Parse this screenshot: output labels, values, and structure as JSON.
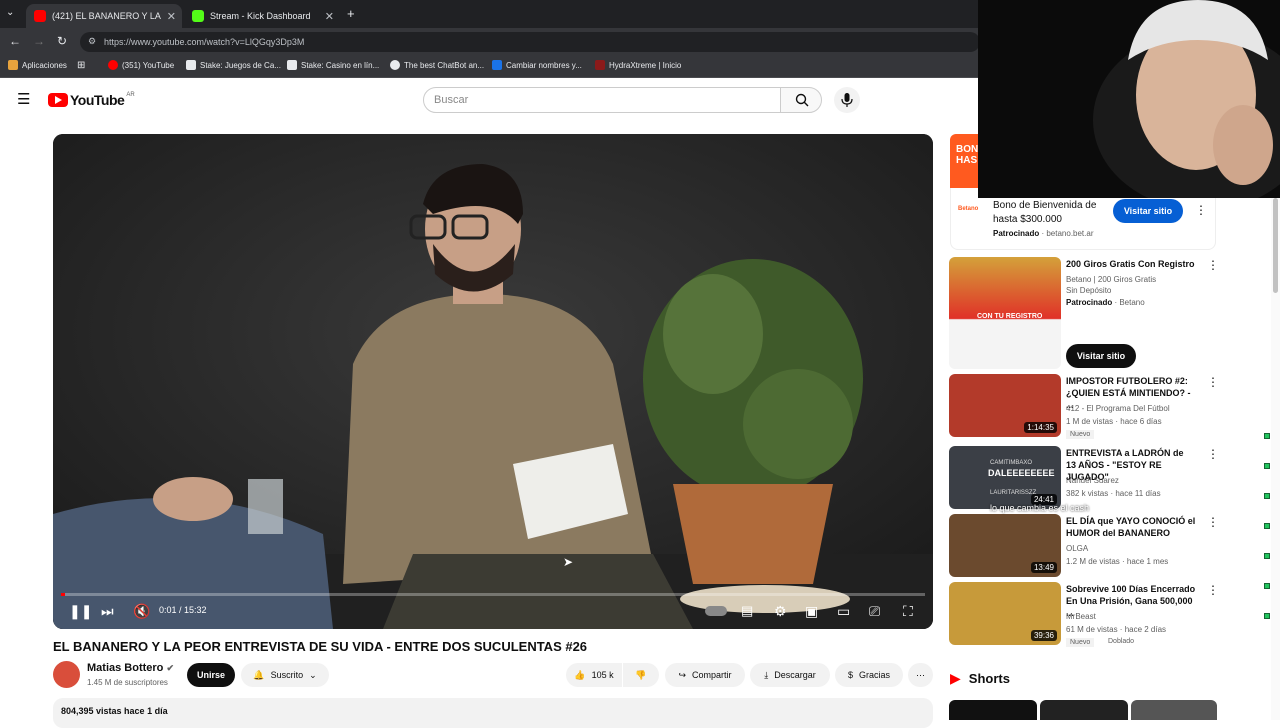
{
  "tabs": [
    {
      "title": "(421) EL BANANERO Y LA PEOR",
      "fav_color": "#ff0000"
    },
    {
      "title": "Stream - Kick Dashboard",
      "fav_color": "#53fc18"
    }
  ],
  "url": "https://www.youtube.com/watch?v=LlQGqy3Dp3M",
  "bookmarks": [
    {
      "label": "Aplicaciones",
      "color": "#e8a33d"
    },
    {
      "label": "(351) YouTube",
      "color": "#ff0000"
    },
    {
      "label": "Stake: Juegos de Ca...",
      "color": "#e8eaed"
    },
    {
      "label": "Stake: Casino en lín...",
      "color": "#e8eaed"
    },
    {
      "label": "The best ChatBot an...",
      "color": "#e8eaed"
    },
    {
      "label": "Cambiar nombres y...",
      "color": "#1a73e8"
    },
    {
      "label": "HydraXtreme | Inicio",
      "color": "#8b1a1a"
    }
  ],
  "youtube": {
    "logo": "YouTube",
    "region": "AR",
    "search_placeholder": "Buscar"
  },
  "player": {
    "time": "0:01 / 15:32",
    "progress": 0.001
  },
  "video": {
    "title": "EL BANANERO Y LA PEOR ENTREVISTA DE SU VIDA - ENTRE DOS SUCULENTAS #26",
    "channel": "Matias Bottero",
    "subscribers": "1.45 M de suscriptores",
    "join": "Unirse",
    "subscribed": "Suscrito",
    "likes": "105 k",
    "share": "Compartir",
    "download": "Descargar",
    "thanks": "Gracias",
    "views": "804,395 vistas  hace 1 día"
  },
  "ad": {
    "banner": "BONO HAS",
    "title": "Bono de Bienvenida de hasta $300.000",
    "sponsored": "Patrocinado",
    "domain": "betano.bet.ar",
    "cta": "Visitar sitio"
  },
  "ad2": {
    "title": "200 Giros Gratis Con Registro",
    "desc": "Betano | 200 Giros Gratis Sin Depósito",
    "sponsored": "Patrocinado",
    "brand": "Betano",
    "cta": "Visitar sitio"
  },
  "recs": [
    {
      "title": "IMPOSTOR FUTBOLERO #2: ¿QUIEN ESTÁ MINTIENDO? - ...",
      "channel": "412 - El Programa Del Fútbol",
      "meta": "1 M de vistas · hace 6 días",
      "badge": "Nuevo",
      "duration": "1:14:35",
      "thumb": "#b33a2a"
    },
    {
      "title": "ENTREVISTA a LADRÓN de 13 AÑOS - \"ESTOY RE JUGADO\"",
      "channel": "Nahuel Suarez",
      "meta": "382 k vistas · hace 11 días",
      "badge": "",
      "duration": "24:41",
      "thumb": "#3b3f46"
    },
    {
      "title": "EL DÍA que YAYO CONOCIÓ el HUMOR del BANANERO",
      "channel": "OLGA",
      "meta": "1.2 M de vistas · hace 1 mes",
      "badge": "",
      "duration": "13:49",
      "thumb": "#6b4a2e"
    },
    {
      "title": "Sobrevive 100 Días Encerrado En Una Prisión, Gana 500,000 ...",
      "channel": "MrBeast",
      "meta": "61 M de vistas · hace 2 días",
      "badge": "Nuevo",
      "badge2": "Doblado",
      "duration": "39:36",
      "thumb": "#c79a3a"
    }
  ],
  "overlay": {
    "chat_user": "CAMITIMBAXO",
    "chat_msg": "DALEEEEEEEE",
    "chat_user2": "LAURITARISSZZ",
    "chat_msg2": "lo que cambia es el cash"
  },
  "shorts": {
    "label": "Shorts"
  }
}
